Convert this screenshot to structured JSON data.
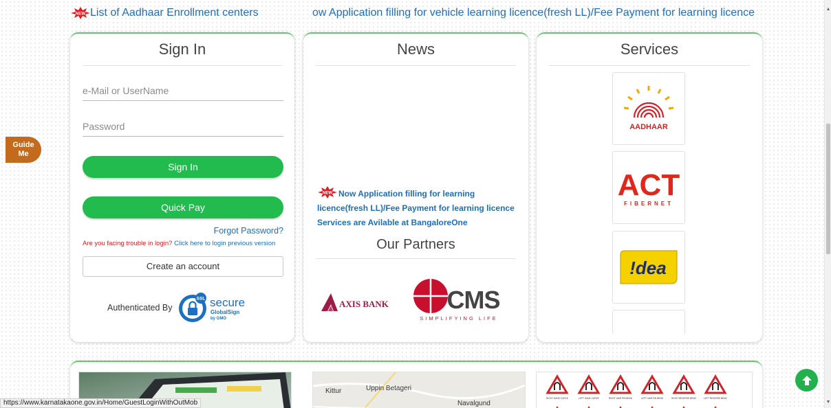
{
  "marquee": {
    "item_1": "List of Aadhaar Enrollment centers",
    "item_2": "ow Application filling for vehicle learning licence(fresh LL)/Fee Payment for learning licence S"
  },
  "signin": {
    "title": "Sign In",
    "email_placeholder": "e-Mail or UserName",
    "password_placeholder": "Password",
    "signin_label": "Sign In",
    "quickpay_label": "Quick Pay",
    "forgot_label": "Forgot Password?",
    "trouble_text": "Are you facing trouble in login?",
    "trouble_link": "Click here to login previous version",
    "create_account_label": "Create an account",
    "authenticated_by": "Authenticated By",
    "ssl_badge": {
      "ssl": "SSL",
      "secure": "secure",
      "globalsign": "GlobalSign",
      "gmo": "by GMO"
    }
  },
  "news": {
    "title": "News",
    "item": "Now Application filling for learning licence(fresh LL)/Fee Payment for learning licence Services are Avilable at BangaloreOne",
    "partners_title": "Our Partners",
    "partners": [
      {
        "name": "AXIS BANK"
      },
      {
        "name": "CMS",
        "tagline": "SIMPLIFYING LIFE"
      }
    ]
  },
  "services": {
    "title": "Services",
    "tiles": [
      {
        "name": "AADHAAR"
      },
      {
        "name": "ACT",
        "tagline": "FIBERNET"
      },
      {
        "name": "!dea"
      }
    ]
  },
  "new_badge": "NEW",
  "guide": {
    "label_1": "Guide",
    "label_2": "Me"
  },
  "map": {
    "label_1": "Kittur",
    "label_2": "Uppin Betageri",
    "label_3": "Navalgund"
  },
  "road_signs": [
    "RIGHT HAND CURVE",
    "LEFT HAND CURVE",
    "RIGHT HAIR PIN BEND",
    "LEFT HAIR PIN BEND",
    "RIGHT REVERSE BEND",
    "LEFT REVERSE BEND"
  ],
  "status_bar": {
    "url": "https://www.karnatakaone.gov.in/Home/GuestLoginWithOutMob"
  },
  "colors": {
    "accent_green": "#22bb4e",
    "link_blue": "#1e6fb8",
    "guide_orange": "#c36a1d",
    "alert_red": "#e0191f"
  }
}
